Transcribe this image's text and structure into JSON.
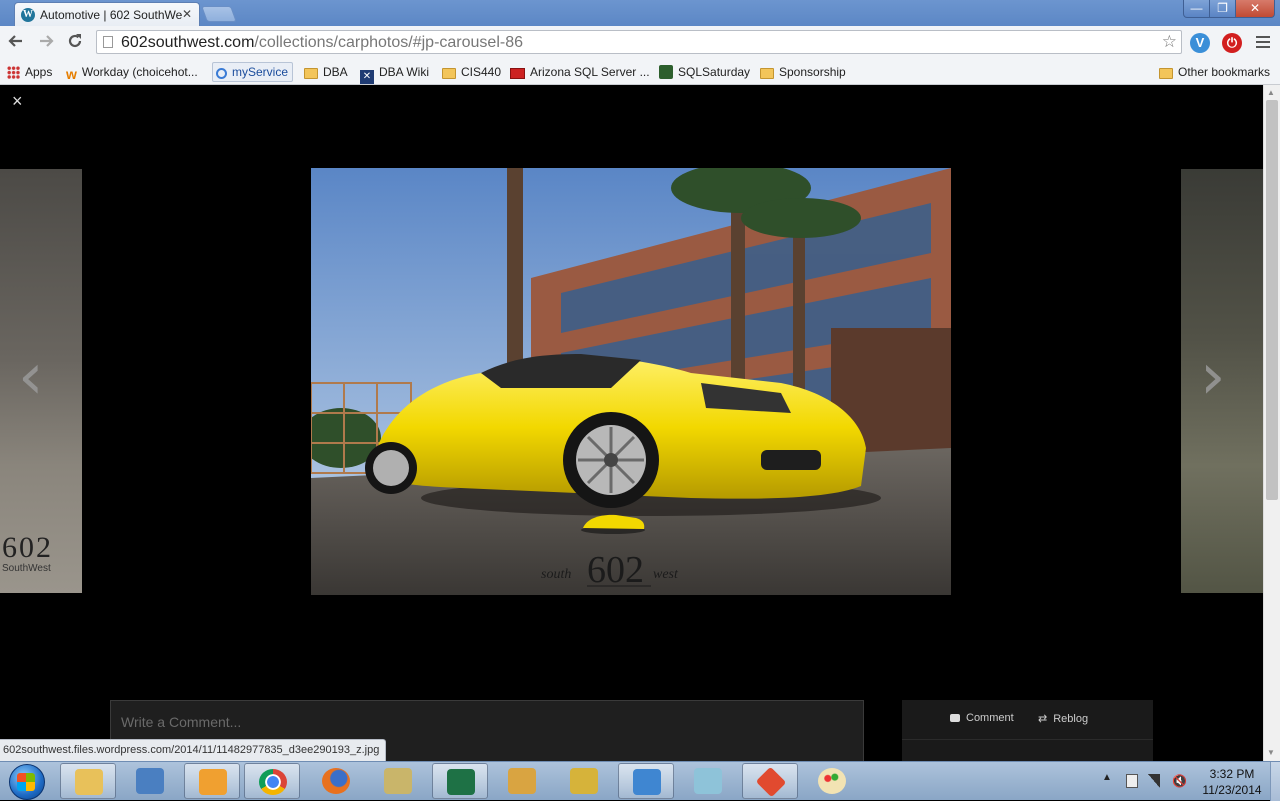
{
  "tab": {
    "title": "Automotive | 602 SouthWest",
    "close": "✕"
  },
  "window": {
    "minimize": "—",
    "maximize": "❐",
    "close": "✕"
  },
  "toolbar": {
    "url_host": "602southwest.com",
    "url_path": "/collections/carphotos/#jp-carousel-86"
  },
  "bookmarks": {
    "apps": "Apps",
    "workday": "Workday (choicehot...",
    "myservice": "myService",
    "dba": "DBA",
    "dba_wiki": "DBA Wiki",
    "cis440": "CIS440",
    "arizona_sql": "Arizona SQL Server ...",
    "sqlsaturday": "SQLSaturday",
    "sponsorship": "Sponsorship",
    "other": "Other bookmarks"
  },
  "carousel": {
    "close": "×",
    "prev_arrow": "‹",
    "next_arrow": "›",
    "watermark_main": "602",
    "watermark_left": "south",
    "watermark_right": "west",
    "prev_logo": "602",
    "prev_logo_sub": "SouthWest"
  },
  "comments": {
    "placeholder": "Write a Comment...",
    "comment_label": "Comment",
    "reblog_label": "Reblog"
  },
  "status_url": "602southwest.files.wordpress.com/2014/11/11482977835_d3ee290193_z.jpg",
  "clock": {
    "time": "3:32 PM",
    "date": "11/23/2014"
  },
  "colors": {
    "car": "#f2d800",
    "chrome_frame": "#6c95cf",
    "page_bg": "#000000"
  }
}
